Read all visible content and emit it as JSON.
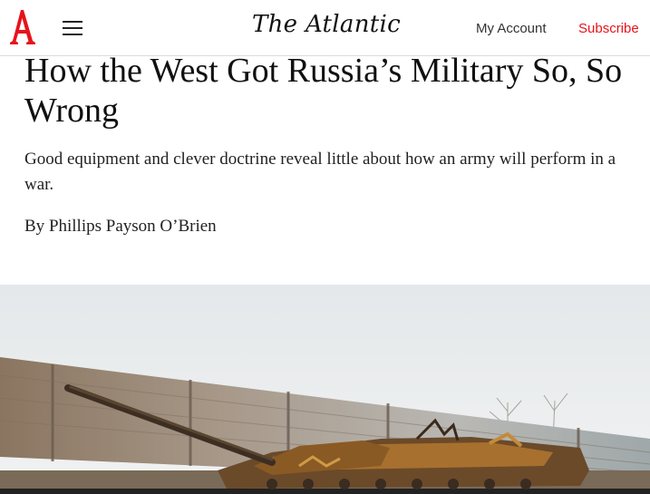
{
  "header": {
    "logo_letter": "A",
    "wordmark": "The Atlantic",
    "my_account": "My Account",
    "subscribe": "Subscribe",
    "brand_red": "#e7131a"
  },
  "icons": {
    "logo": "atlantic-a-logo-icon",
    "menu": "hamburger-menu-icon"
  },
  "article": {
    "headline": "How the West Got Russia’s Military So, So Wrong",
    "dek": "Good equipment and clever doctrine reveal little about how an army will perform in a war.",
    "byline_prefix": "By ",
    "author": "Phillips Payson O’Brien"
  }
}
